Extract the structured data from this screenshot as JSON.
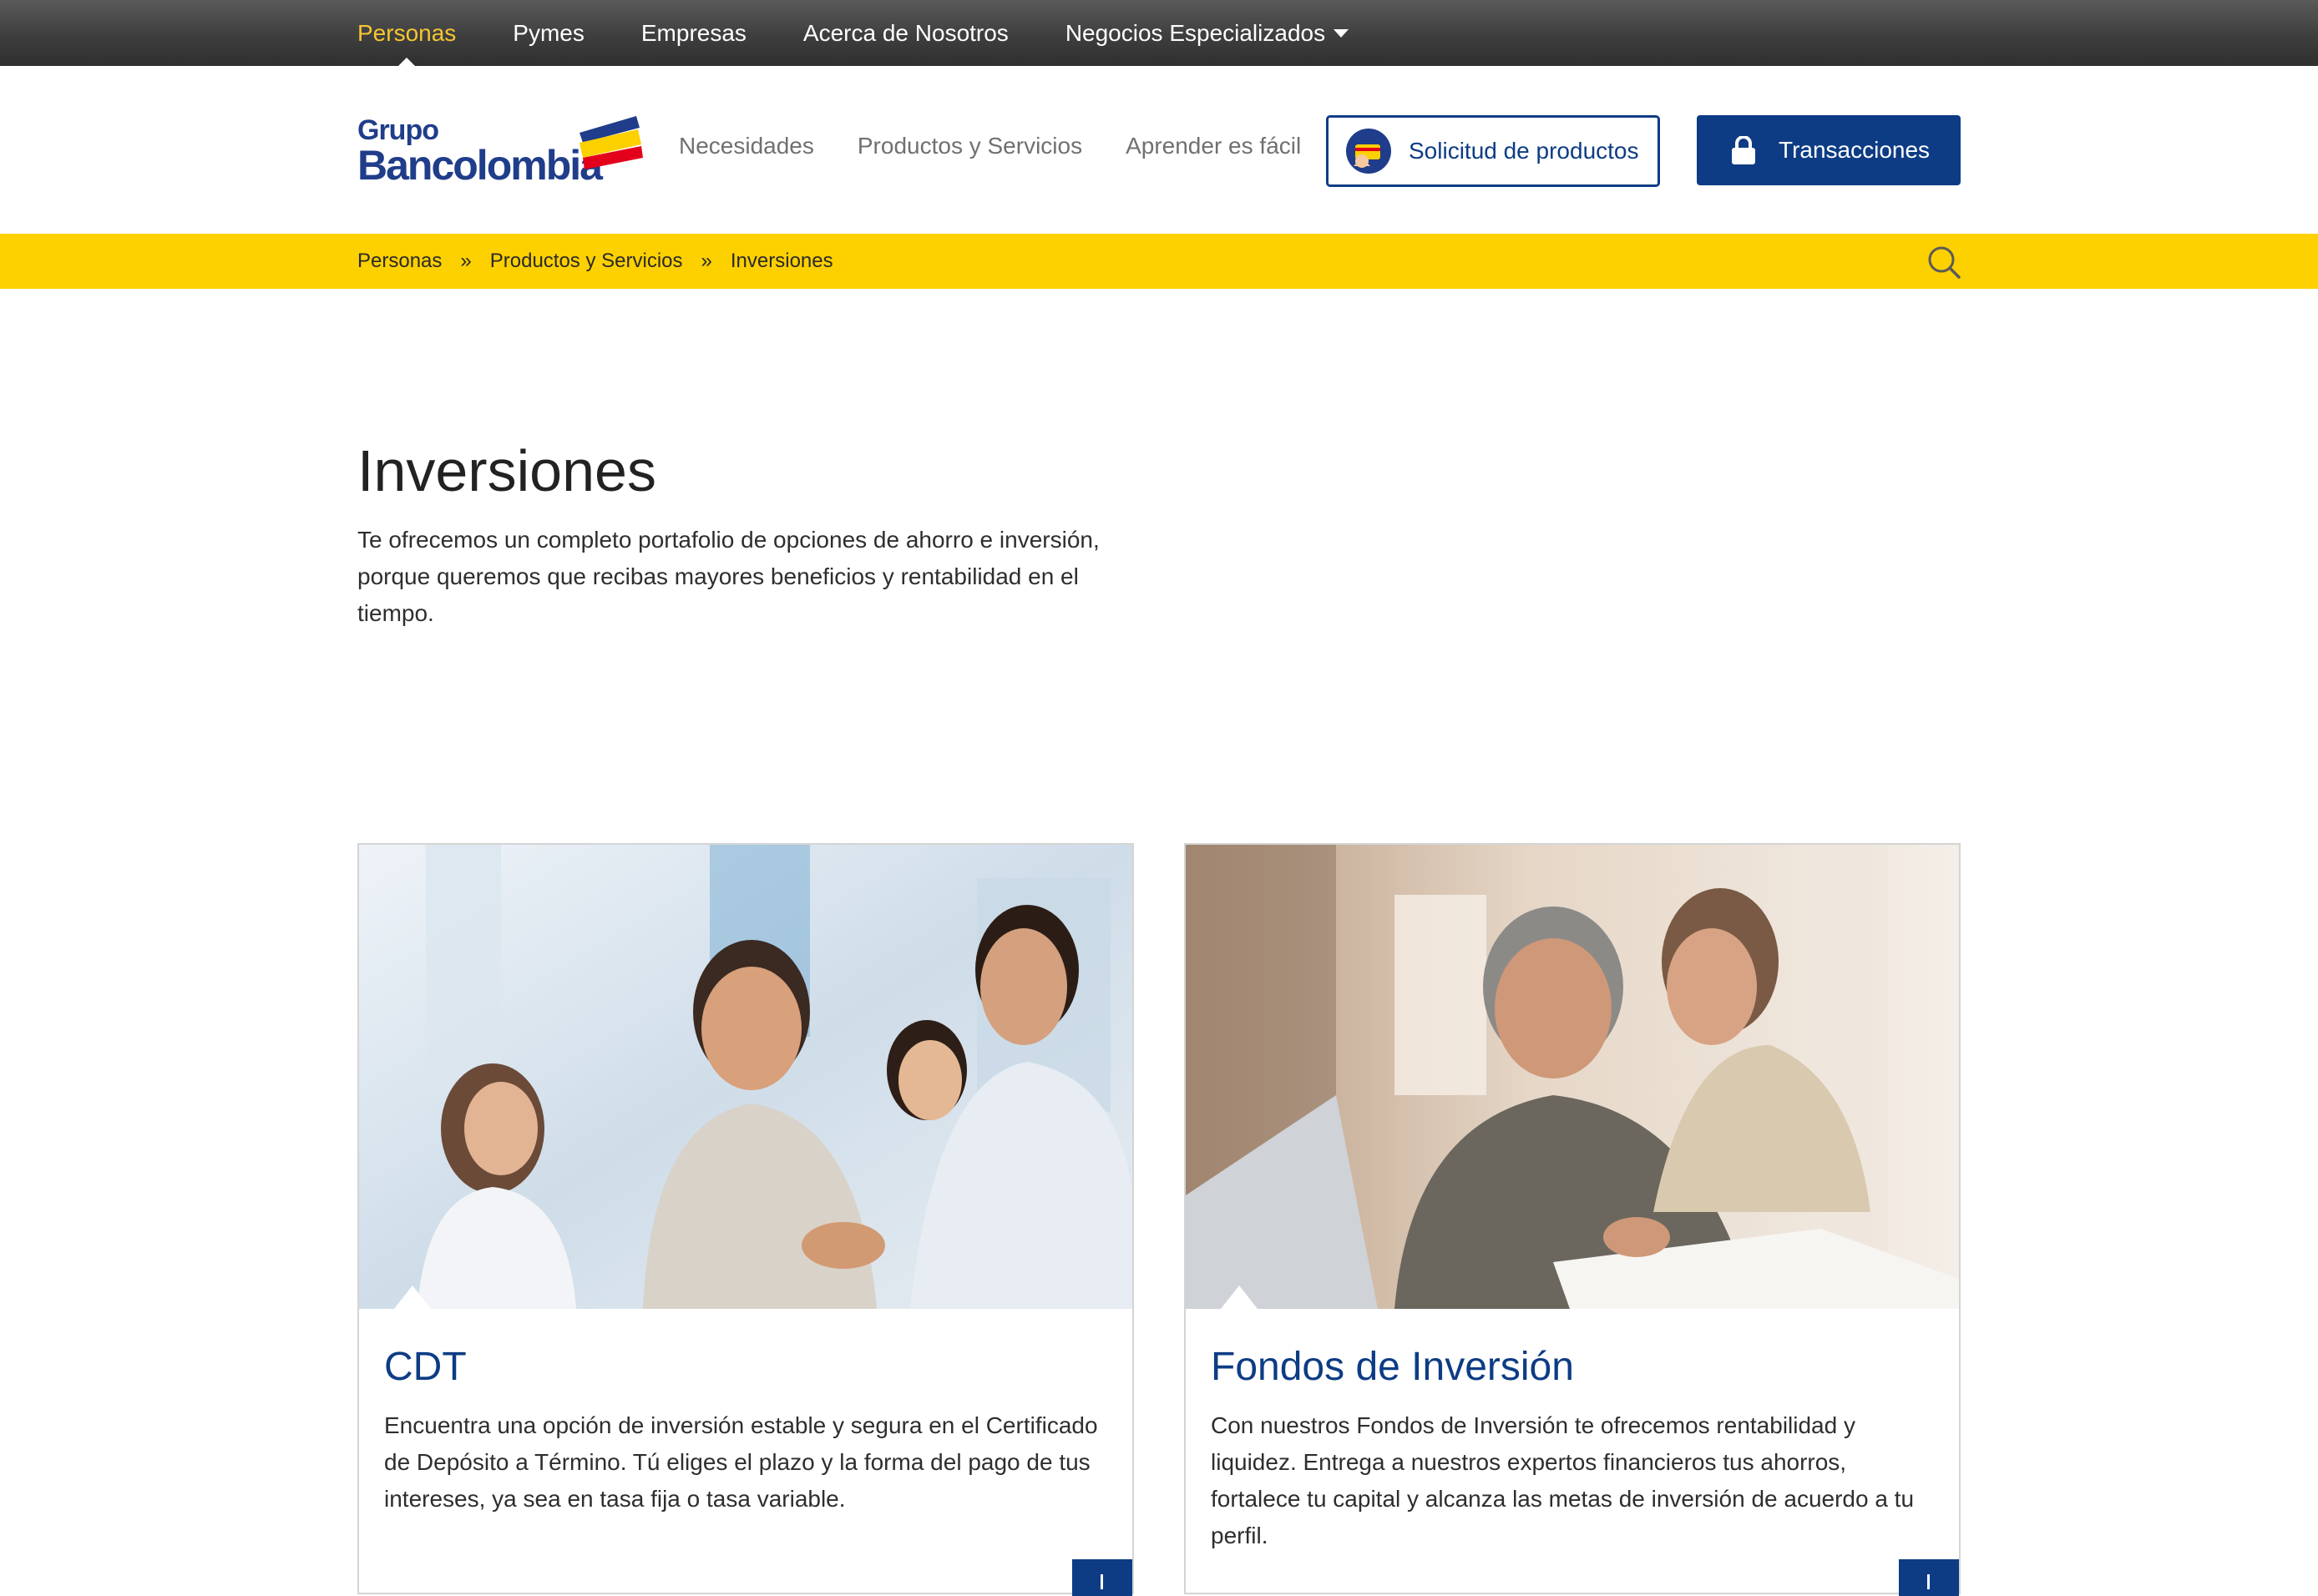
{
  "topnav": {
    "items": [
      {
        "label": "Personas",
        "active": true
      },
      {
        "label": "Pymes"
      },
      {
        "label": "Empresas"
      },
      {
        "label": "Acerca de Nosotros"
      },
      {
        "label": "Negocios Especializados",
        "dropdown": true
      }
    ]
  },
  "header": {
    "logo": {
      "line1": "Grupo",
      "line2": "Bancolombia"
    },
    "nav": [
      {
        "label": "Necesidades"
      },
      {
        "label": "Productos y Servicios"
      },
      {
        "label": "Aprender es fácil"
      }
    ],
    "solicitud_label": "Solicitud de productos",
    "transacciones_label": "Transacciones"
  },
  "breadcrumb": {
    "items": [
      "Personas",
      "Productos y Servicios",
      "Inversiones"
    ],
    "separator": "»",
    "search_icon": "search-icon"
  },
  "main": {
    "title": "Inversiones",
    "intro": "Te ofrecemos un completo portafolio de opciones de ahorro e inversión, porque queremos que recibas mayores beneficios y rentabilidad en el tiempo."
  },
  "cards": [
    {
      "title": "CDT",
      "text": "Encuentra una opción de inversión estable y segura en el Certificado de Depósito a Término. Tú eliges el plazo y la forma del pago de tus intereses, ya sea en tasa fija o tasa variable."
    },
    {
      "title": "Fondos de Inversión",
      "text": "Con nuestros Fondos de Inversión te ofrecemos rentabilidad y liquidez. Entrega a nuestros expertos financieros tus ahorros, fortalece tu capital y alcanza las metas de inversión de acuerdo a tu perfil."
    }
  ],
  "colors": {
    "brand_blue": "#0d3c85",
    "accent_yellow": "#fdd000",
    "active_top": "#f7c531"
  }
}
